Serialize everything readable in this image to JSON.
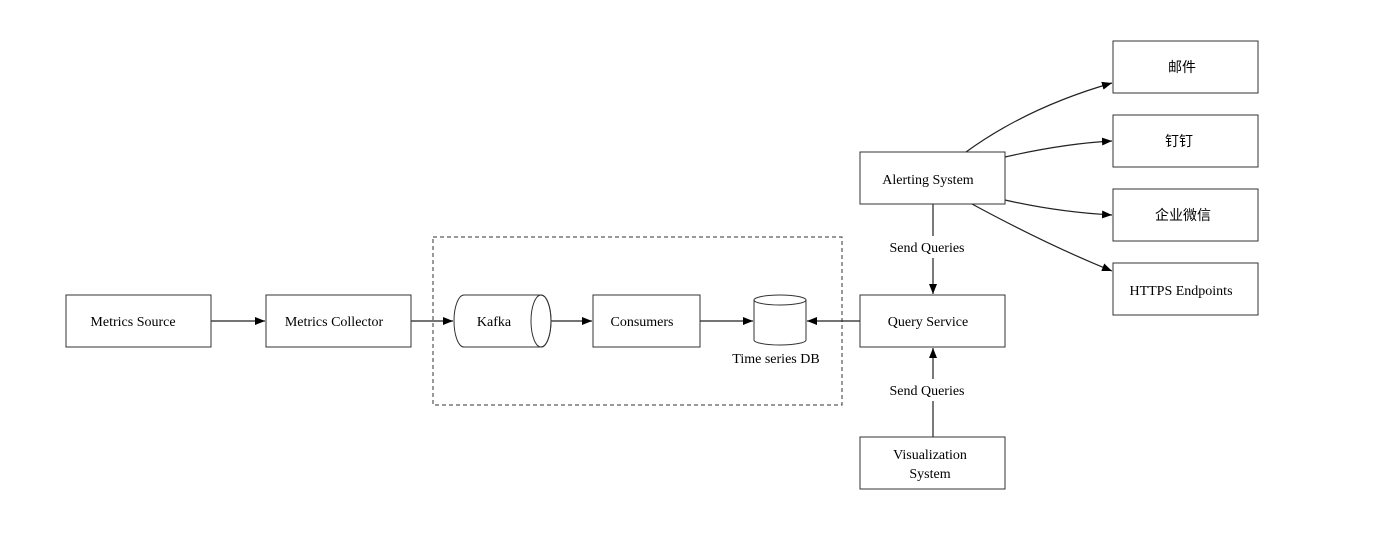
{
  "nodes": {
    "metrics_source": "Metrics Source",
    "metrics_collector": "Metrics Collector",
    "kafka": "Kafka",
    "consumers": "Consumers",
    "tsdb": "Time series DB",
    "query_service": "Query Service",
    "alerting": "Alerting System",
    "visualization_line1": "Visualization",
    "visualization_line2": "System",
    "email": "邮件",
    "dingtalk": "钉钉",
    "wecom": "企业微信",
    "https": "HTTPS Endpoints"
  },
  "edges": {
    "alert_to_query": "Send Queries",
    "viz_to_query": "Send Queries"
  },
  "colors": {
    "stroke": "#333333",
    "background": "#ffffff"
  }
}
